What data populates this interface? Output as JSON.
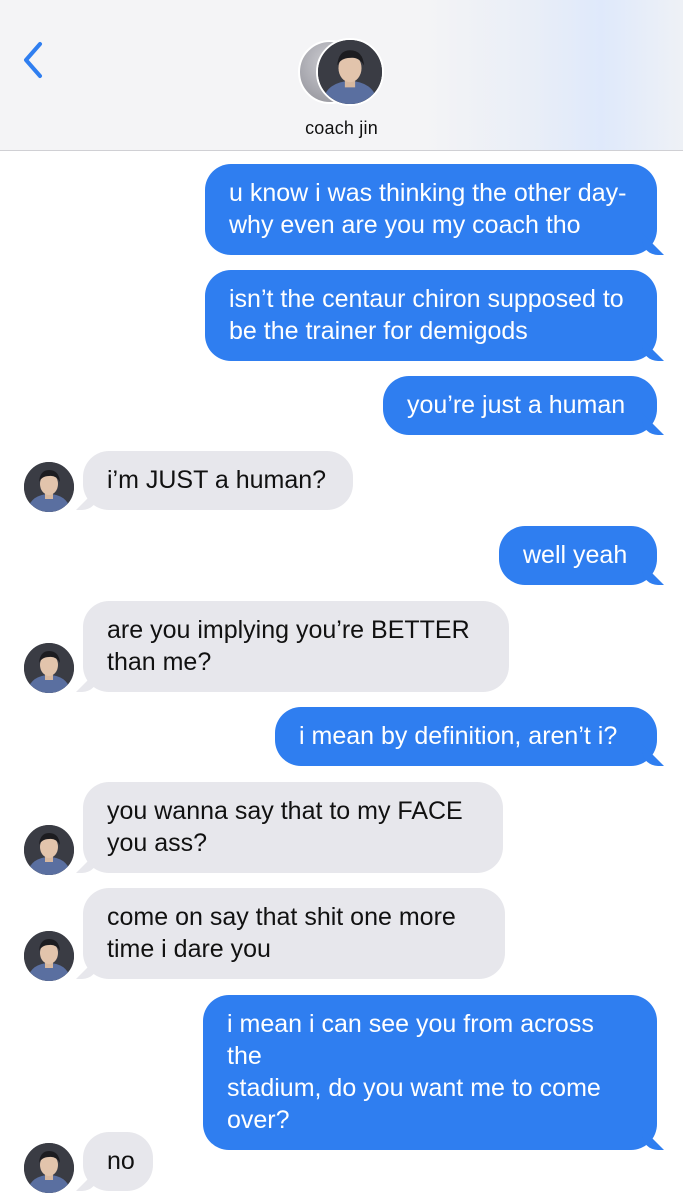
{
  "header": {
    "contact_name": "coach jin",
    "back_icon": "chevron-left-icon",
    "accent_color": "#2f7ef0"
  },
  "colors": {
    "outgoing_bubble": "#2f7ef0",
    "incoming_bubble": "#e7e7ec"
  },
  "messages": [
    {
      "direction": "out",
      "text": "u know i was thinking the other day-\nwhy even are you my coach tho"
    },
    {
      "direction": "out",
      "text": "isn’t the centaur chiron supposed to\nbe the trainer for demigods"
    },
    {
      "direction": "out",
      "text": "you’re just a human"
    },
    {
      "direction": "in",
      "text": "i’m JUST a human?"
    },
    {
      "direction": "out",
      "text": "well yeah"
    },
    {
      "direction": "in",
      "text": "are you implying you’re BETTER\nthan me?"
    },
    {
      "direction": "out",
      "text": "i mean by definition, aren’t i?"
    },
    {
      "direction": "in",
      "text": "you wanna say that to my FACE\nyou ass?"
    },
    {
      "direction": "in",
      "text": "come on say that shit one more\ntime i dare you"
    },
    {
      "direction": "out",
      "text": "i mean i can see you from across the\nstadium, do you want me to come\nover?"
    },
    {
      "direction": "in",
      "text": "no"
    }
  ]
}
